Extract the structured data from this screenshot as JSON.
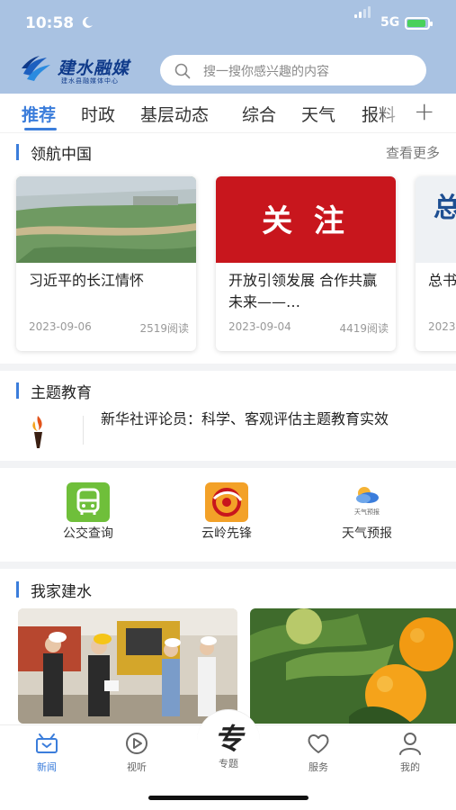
{
  "status": {
    "time": "10:58",
    "network": "5G"
  },
  "header": {
    "logo_name": "建水融媒",
    "logo_sub": "建水县融媒体中心",
    "search_placeholder": "搜一搜你感兴趣的内容"
  },
  "tabs": [
    "推荐",
    "时政",
    "基层动态",
    "综合",
    "天气",
    "报料"
  ],
  "sections": {
    "navigate": {
      "title": "领航中国",
      "more": "查看更多"
    },
    "education": {
      "title": "主题教育",
      "headline": "新华社评论员：科学、客观评估主题教育实效"
    },
    "home": {
      "title": "我家建水"
    }
  },
  "cards": [
    {
      "title": "习近平的长江情怀",
      "date": "2023-09-06",
      "reads": "2519阅读"
    },
    {
      "title": "开放引领发展 合作共赢未来——…",
      "date": "2023-09-04",
      "reads": "4419阅读",
      "banner": "关 注"
    },
    {
      "title": "总书",
      "date": "2023",
      "banner": "总"
    }
  ],
  "services": [
    {
      "label": "公交查询",
      "icon": "bus-icon"
    },
    {
      "label": "云岭先锋",
      "icon": "yunling-logo-icon"
    },
    {
      "label": "天气预报",
      "icon": "weather-icon",
      "icon_caption": "天气预报"
    }
  ],
  "bottom_nav": [
    {
      "label": "新闻",
      "icon": "news-icon",
      "active": true
    },
    {
      "label": "视听",
      "icon": "play-icon"
    },
    {
      "label": "专题",
      "icon": "special-topic-icon",
      "glyph": "专"
    },
    {
      "label": "服务",
      "icon": "heart-icon"
    },
    {
      "label": "我的",
      "icon": "user-icon"
    }
  ],
  "colors": {
    "header_bg": "#a9c2e2",
    "accent": "#3b7ddb",
    "banner_red": "#c8161d"
  }
}
